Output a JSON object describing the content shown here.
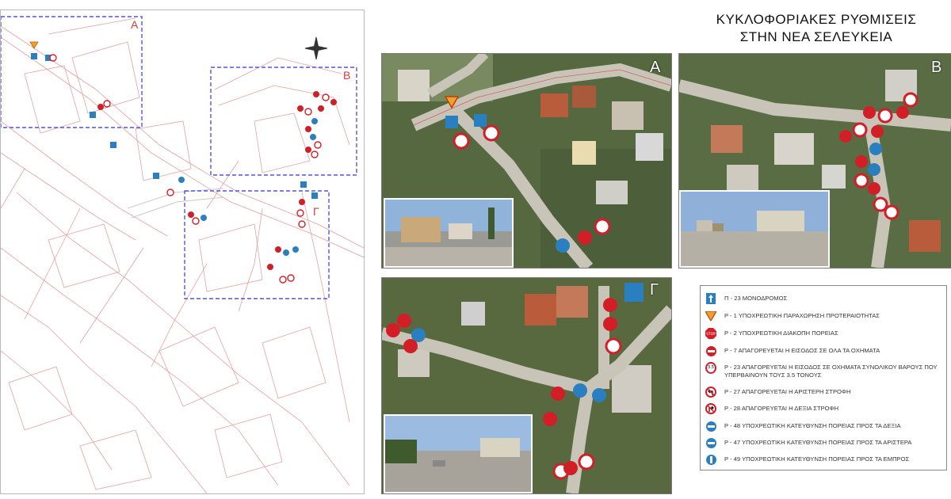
{
  "title": {
    "line1": "ΚΥΚΛΟΦΟΡΙΑΚΕΣ ΡΥΘΜΙΣΕΙΣ",
    "line2": "ΣΤΗΝ ΝΕΑ ΣΕΛΕΥΚΕΙΑ"
  },
  "plan": {
    "zone_labels": [
      "A",
      "B",
      "Γ"
    ]
  },
  "panels": {
    "a_letter": "A",
    "b_letter": "B",
    "c_letter": "Γ"
  },
  "legend": {
    "items": [
      {
        "icon": "one-way-sign-icon",
        "text": "Π - 23 ΜΟΝΟΔΡΟΜΟΣ"
      },
      {
        "icon": "yield-sign-icon",
        "text": "Ρ - 1 ΥΠΟΧΡΕΩΤΙΚΗ ΠΑΡΑΧΩΡΗΣΗ ΠΡΟΤΕΡΑΙΟΤΗΤΑΣ"
      },
      {
        "icon": "stop-sign-icon",
        "text": "Ρ - 2 ΥΠΟΧΡΕΩΤΙΚΗ ΔΙΑΚΟΠΗ ΠΟΡΕΙΑΣ"
      },
      {
        "icon": "no-entry-sign-icon",
        "text": "Ρ - 7 ΑΠΑΓΟΡΕΥΕΤΑΙ Η ΕΙΣΟΔΟΣ ΣΕ ΟΛΑ ΤΑ ΟΧΗΜΑΤΑ"
      },
      {
        "icon": "weight-limit-sign-icon",
        "text": "Ρ - 23 ΑΠΑΓΟΡΕΥΕΤΑΙ Η ΕΙΣΟΔΟΣ ΣΕ ΟΧΗΜΑΤΑ ΣΥΝΟΛΙΚΟΥ ΒΑΡΟΥΣ ΠΟΥ ΥΠΕΡΒΑΙΝΟΥΝ ΤΟΥΣ 3.5 ΤΟΝΟΥΣ"
      },
      {
        "icon": "no-left-turn-sign-icon",
        "text": "Ρ - 27 ΑΠΑΓΟΡΕΥΕΤΑΙ Η ΑΡΙΣΤΕΡΗ ΣΤΡΟΦΗ"
      },
      {
        "icon": "no-right-turn-sign-icon",
        "text": "Ρ - 28 ΑΠΑΓΟΡΕΥΕΤΑΙ Η ΔΕΞΙΑ ΣΤΡΟΦΗ"
      },
      {
        "icon": "turn-right-sign-icon",
        "text": "Ρ - 48 ΥΠΟΧΡΕΩΤΙΚΗ ΚΑΤΕΥΘΥΝΣΗ ΠΟΡΕΙΑΣ ΠΡΟΣ ΤΑ ΔΕΞΙΑ"
      },
      {
        "icon": "turn-left-sign-icon",
        "text": "Ρ - 47 ΥΠΟΧΡΕΩΤΙΚΗ ΚΑΤΕΥΘΥΝΣΗ ΠΟΡΕΙΑΣ ΠΡΟΣ ΤΑ ΑΡΙΣΤΕΡΑ"
      },
      {
        "icon": "ahead-only-sign-icon",
        "text": "Ρ - 49 ΥΠΟΧΡΕΩΤΙΚΗ ΚΑΤΕΥΘΥΝΣΗ ΠΟΡΕΙΑΣ ΠΡΟΣ ΤΑ ΕΜΠΡΟΣ"
      }
    ]
  },
  "colors": {
    "sign_blue": "#2a7fc0",
    "sign_red": "#d21f27",
    "zone_border": "#5454d8",
    "parcel_line": "#e08a8a"
  }
}
